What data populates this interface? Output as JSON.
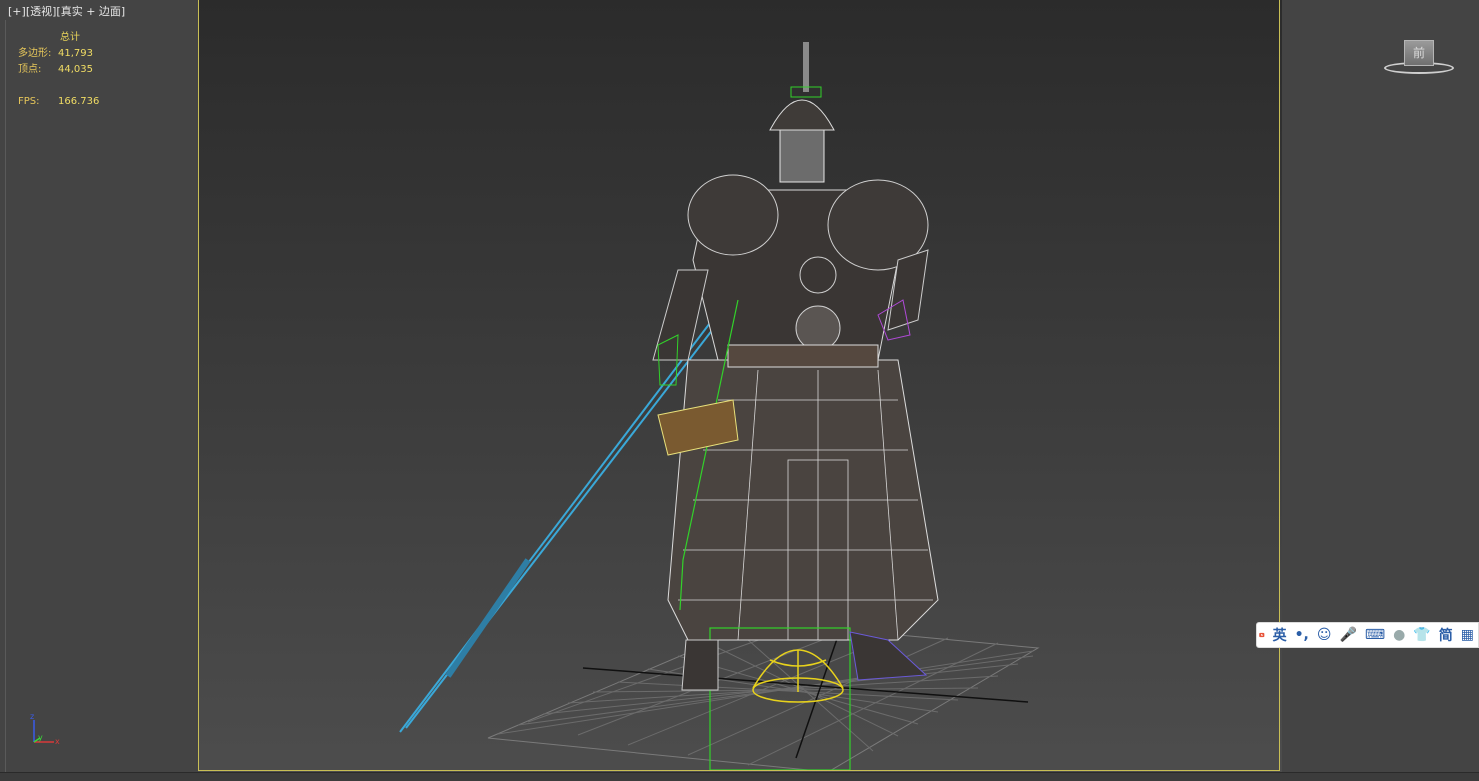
{
  "viewport": {
    "label_plus": "[+]",
    "label_view": "[透视]",
    "label_shading": "[真实 + 边面]"
  },
  "stats": {
    "header": "总计",
    "polys_label": "多边形:",
    "polys_value": "41,793",
    "verts_label": "顶点:",
    "verts_value": "44,035",
    "fps_label": "FPS:",
    "fps_value": "166.736"
  },
  "viewcube": {
    "face": "前"
  },
  "axis": {
    "z": "z",
    "y": "y",
    "x": "x"
  },
  "ime": {
    "lang": "英",
    "punct": "•,",
    "simplified": "简"
  },
  "colors": {
    "safe_frame": "#c9bf55",
    "stats_text": "#e8d35a",
    "wire_white": "#e6e6e6",
    "wire_green": "#32d22a",
    "wire_cyan": "#3aa8d8",
    "gizmo_yellow": "#e8d21c"
  }
}
